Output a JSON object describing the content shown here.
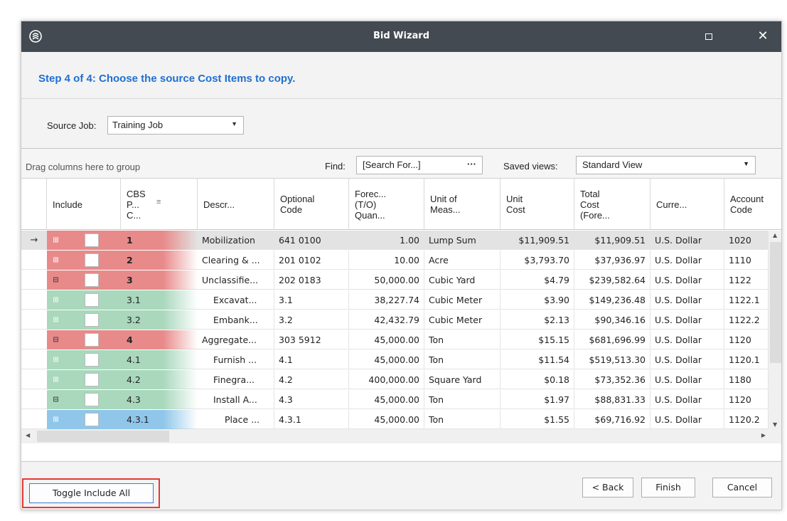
{
  "window": {
    "title": "Bid Wizard",
    "logo_icon": "swirl-logo-icon",
    "maximize_icon": "maximize-icon",
    "close_icon": "close-icon",
    "close_glyph": "✕"
  },
  "step_heading": "Step 4 of 4: Choose the source Cost Items to copy.",
  "source": {
    "label": "Source Job:",
    "value": "Training Job"
  },
  "toolbar": {
    "drag_hint": "Drag columns here to group",
    "find_label": "Find:",
    "find_placeholder": "[Search For...]",
    "find_button": "···",
    "saved_views_label": "Saved views:",
    "saved_views_value": "Standard View"
  },
  "columns": {
    "include": "Include",
    "cbs": [
      "CBS",
      "P...",
      "C..."
    ],
    "desc": "Descr...",
    "opt": [
      "Optional",
      "Code"
    ],
    "forecast": [
      "Forec...",
      "(T/O)",
      "Quan..."
    ],
    "unit_meas": [
      "Unit of",
      "Meas..."
    ],
    "unit_cost": [
      "Unit",
      "Cost"
    ],
    "total": [
      "Total",
      "Cost",
      "(Fore..."
    ],
    "currency": "Curre...",
    "account": [
      "Account",
      "Code"
    ]
  },
  "colors": {
    "red": "#e88a8a",
    "green": "#a9d8bd",
    "blue": "#8fc6ea",
    "accent": "#1f6fd1",
    "titlebar": "#434a51"
  },
  "rows": [
    {
      "indicator": "→",
      "exp": "⊞",
      "level": "red",
      "cbs": "1",
      "bold": true,
      "desc": "Mobilization",
      "indent": 0,
      "opt": "641 0100",
      "qty": "1.00",
      "uom": "Lump Sum",
      "unit_cost": "$11,909.51",
      "total": "$11,909.51",
      "currency": "U.S. Dollar",
      "account": "1020"
    },
    {
      "indicator": "",
      "exp": "⊞",
      "level": "red",
      "cbs": "2",
      "bold": true,
      "desc": "Clearing & ...",
      "indent": 0,
      "opt": "201 0102",
      "qty": "10.00",
      "uom": "Acre",
      "unit_cost": "$3,793.70",
      "total": "$37,936.97",
      "currency": "U.S. Dollar",
      "account": "1110"
    },
    {
      "indicator": "",
      "exp": "⊟",
      "level": "red",
      "cbs": "3",
      "bold": true,
      "desc": "Unclassifie...",
      "indent": 0,
      "opt": "202 0183",
      "qty": "50,000.00",
      "uom": "Cubic Yard",
      "unit_cost": "$4.79",
      "total": "$239,582.64",
      "currency": "U.S. Dollar",
      "account": "1122"
    },
    {
      "indicator": "",
      "exp": "⊞",
      "level": "green",
      "cbs": "3.1",
      "bold": false,
      "desc": "Excavat...",
      "indent": 1,
      "opt": "3.1",
      "qty": "38,227.74",
      "uom": "Cubic Meter",
      "unit_cost": "$3.90",
      "total": "$149,236.48",
      "currency": "U.S. Dollar",
      "account": "1122.1"
    },
    {
      "indicator": "",
      "exp": "⊞",
      "level": "green",
      "cbs": "3.2",
      "bold": false,
      "desc": "Embank...",
      "indent": 1,
      "opt": "3.2",
      "qty": "42,432.79",
      "uom": "Cubic Meter",
      "unit_cost": "$2.13",
      "total": "$90,346.16",
      "currency": "U.S. Dollar",
      "account": "1122.2"
    },
    {
      "indicator": "",
      "exp": "⊟",
      "level": "red",
      "cbs": "4",
      "bold": true,
      "desc": "Aggregate...",
      "indent": 0,
      "opt": "303 5912",
      "qty": "45,000.00",
      "uom": "Ton",
      "unit_cost": "$15.15",
      "total": "$681,696.99",
      "currency": "U.S. Dollar",
      "account": "1120"
    },
    {
      "indicator": "",
      "exp": "⊞",
      "level": "green",
      "cbs": "4.1",
      "bold": false,
      "desc": "Furnish ...",
      "indent": 1,
      "opt": "4.1",
      "qty": "45,000.00",
      "uom": "Ton",
      "unit_cost": "$11.54",
      "total": "$519,513.30",
      "currency": "U.S. Dollar",
      "account": "1120.1"
    },
    {
      "indicator": "",
      "exp": "⊞",
      "level": "green",
      "cbs": "4.2",
      "bold": false,
      "desc": "Finegra...",
      "indent": 1,
      "opt": "4.2",
      "qty": "400,000.00",
      "uom": "Square Yard",
      "unit_cost": "$0.18",
      "total": "$73,352.36",
      "currency": "U.S. Dollar",
      "account": "1180"
    },
    {
      "indicator": "",
      "exp": "⊟",
      "level": "green",
      "cbs": "4.3",
      "bold": false,
      "desc": "Install A...",
      "indent": 1,
      "opt": "4.3",
      "qty": "45,000.00",
      "uom": "Ton",
      "unit_cost": "$1.97",
      "total": "$88,831.33",
      "currency": "U.S. Dollar",
      "account": "1120"
    },
    {
      "indicator": "",
      "exp": "⊞",
      "level": "blue",
      "cbs": "4.3.1",
      "bold": false,
      "desc": "Place ...",
      "indent": 2,
      "opt": "4.3.1",
      "qty": "45,000.00",
      "uom": "Ton",
      "unit_cost": "$1.55",
      "total": "$69,716.92",
      "currency": "U.S. Dollar",
      "account": "1120.2"
    }
  ],
  "buttons": {
    "toggle": "Toggle Include All",
    "back": "< Back",
    "finish": "Finish",
    "cancel": "Cancel"
  }
}
